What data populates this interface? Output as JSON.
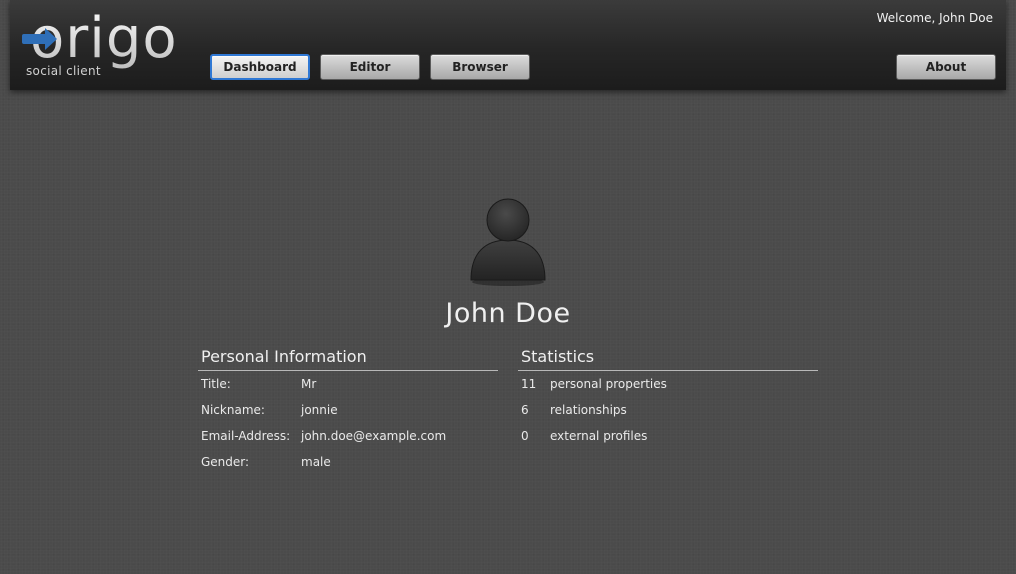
{
  "app": {
    "logo_word": "origo",
    "logo_sub": "social client",
    "welcome": "Welcome, John Doe"
  },
  "nav": {
    "dashboard": "Dashboard",
    "editor": "Editor",
    "browser": "Browser",
    "about": "About",
    "active": "Dashboard"
  },
  "profile": {
    "name": "John Doe",
    "avatar_icon": "person-silhouette-icon"
  },
  "personal_info": {
    "title": "Personal Information",
    "rows": [
      {
        "label": "Title:",
        "value": "Mr"
      },
      {
        "label": "Nickname:",
        "value": "jonnie"
      },
      {
        "label": "Email-Address:",
        "value": "john.doe@example.com"
      },
      {
        "label": "Gender:",
        "value": "male"
      }
    ]
  },
  "statistics": {
    "title": "Statistics",
    "rows": [
      {
        "count": "11",
        "label": "personal properties"
      },
      {
        "count": "6",
        "label": "relationships"
      },
      {
        "count": "0",
        "label": "external profiles"
      }
    ]
  },
  "colors": {
    "background": "#4b4b4b",
    "accent": "#2f78d4",
    "logo_arrow": "#2f6fb8"
  }
}
